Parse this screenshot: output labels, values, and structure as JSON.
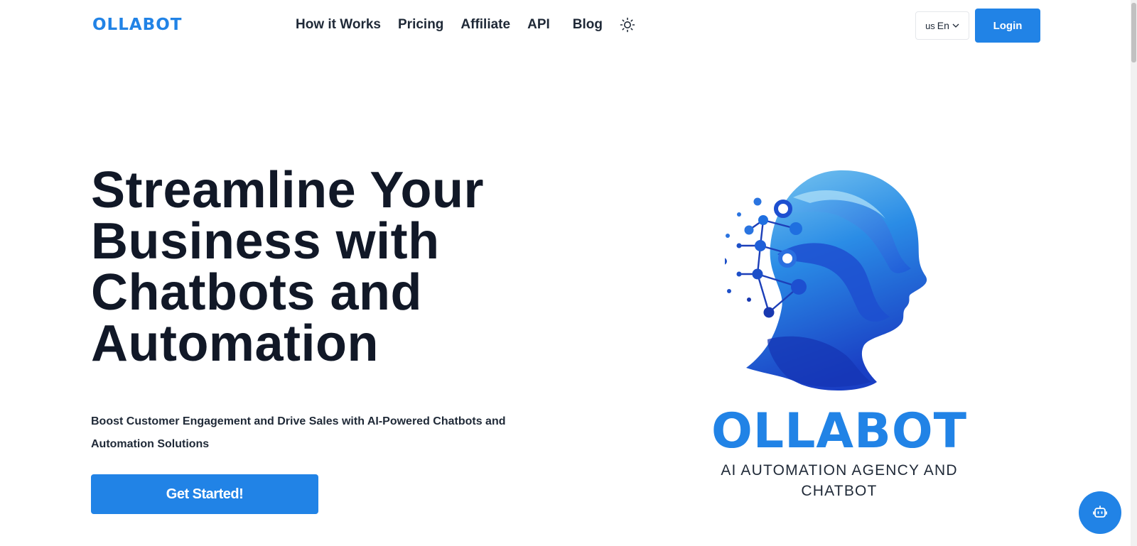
{
  "header": {
    "logo_text": "OLLABOT",
    "nav": [
      {
        "label": "How it Works"
      },
      {
        "label": "Pricing"
      },
      {
        "label": "Affiliate"
      },
      {
        "label": "API"
      },
      {
        "label": "Blog"
      }
    ],
    "theme_icon": "sun-icon",
    "language": {
      "flag_code": "us",
      "selected": "En"
    },
    "login_label": "Login"
  },
  "hero": {
    "title_lines": [
      "Streamline Your",
      "Business with",
      "Chatbots and",
      "Automation"
    ],
    "subtitle_lines": [
      "Boost Customer Engagement and Drive Sales with AI-Powered Chatbots and",
      "Automation Solutions"
    ],
    "cta_label": "Get Started!"
  },
  "brand": {
    "wordmark": "OLLABOT",
    "tagline_lines": [
      "AI AUTOMATION AGENCY AND",
      "CHATBOT"
    ],
    "art_icon": "ai-head-network-icon"
  },
  "chat_widget": {
    "icon": "robot-icon"
  },
  "colors": {
    "accent": "#2183e6",
    "text": "#111827",
    "art_light": "#7cc8f0",
    "art_dark": "#1a3fc4"
  }
}
